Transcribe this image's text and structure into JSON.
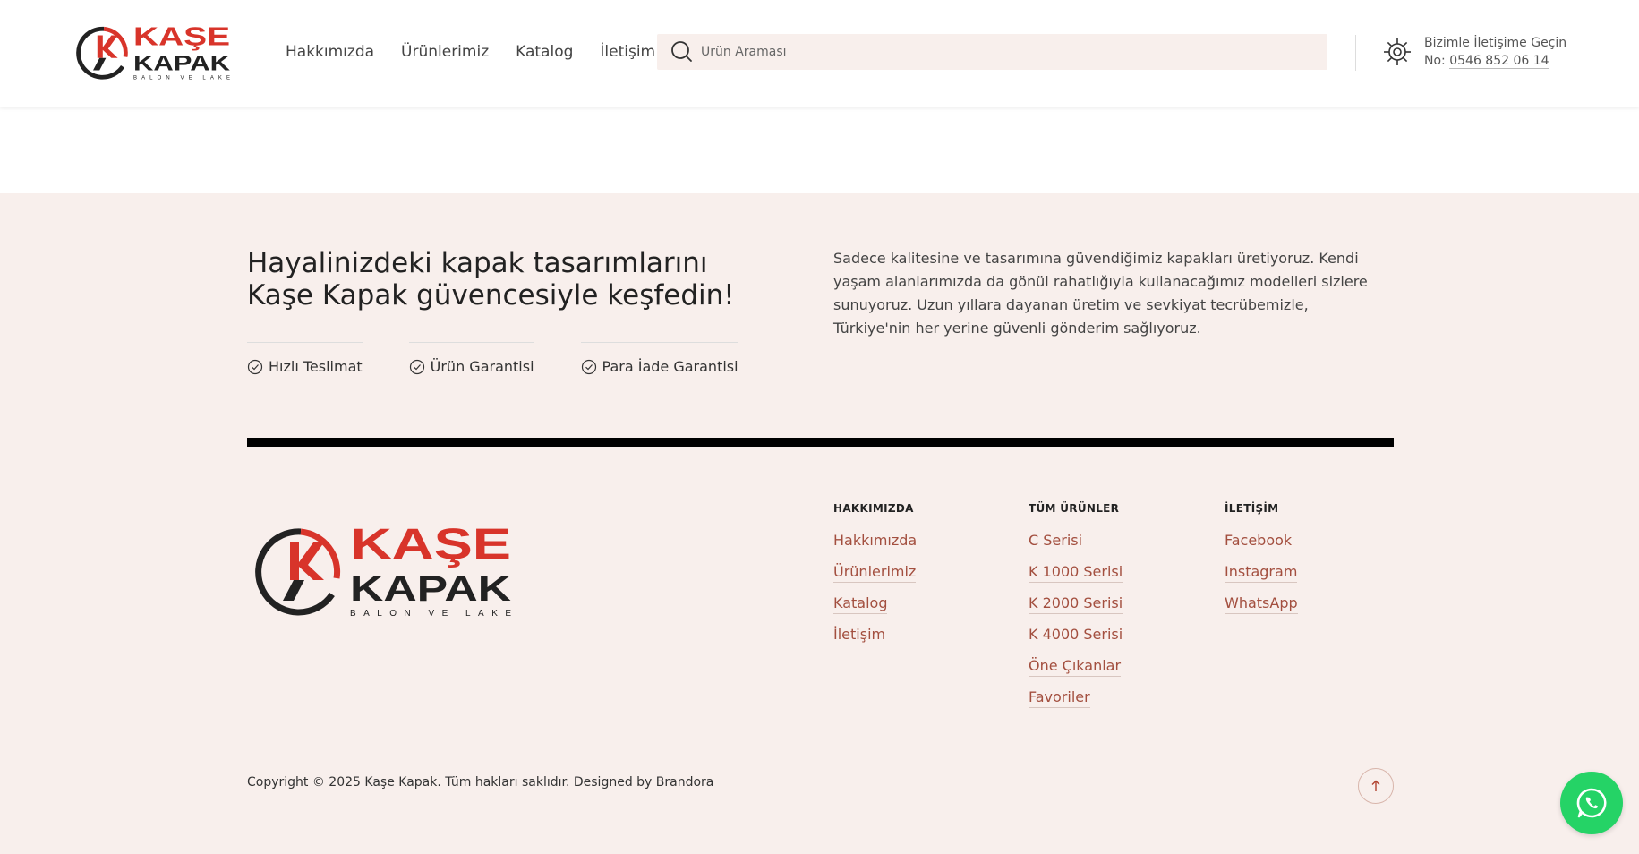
{
  "brand": {
    "name_top": "KAŞE",
    "name_bottom": "KAPAK",
    "subtitle": "BALON VE LAKE",
    "primary_color": "#d8342a",
    "dark_color": "#222222"
  },
  "header": {
    "nav": [
      {
        "label": "Hakkımızda"
      },
      {
        "label": "Ürünlerimiz"
      },
      {
        "label": "Katalog"
      },
      {
        "label": "İletişim"
      }
    ],
    "search": {
      "placeholder": "Ürün Araması",
      "icon": "search-icon"
    },
    "contact": {
      "icon": "gear-icon",
      "line1": "Bizimle İletişime Geçin",
      "prefix": "No:",
      "phone": "0546 852 06 14"
    }
  },
  "footer": {
    "tagline": "Hayalinizdeki kapak tasarımlarını Kaşe Kapak güvencesiyle keşfedin!",
    "badges": [
      {
        "label": "Hızlı Teslimat",
        "icon": "check-circle-icon"
      },
      {
        "label": "Ürün Garantisi",
        "icon": "check-circle-icon"
      },
      {
        "label": "Para İade Garantisi",
        "icon": "check-circle-icon"
      }
    ],
    "about": "Sadece kalitesine ve tasarımına güvendiğimiz kapakları üretiyoruz. Kendi yaşam alanlarımızda da gönül rahatlığıyla kullanacağımız modelleri sizlere sunuyoruz. Uzun yıllara dayanan üretim ve sevkiyat tecrübemizle, Türkiye'nin her yerine güvenli gönderim sağlıyoruz.",
    "columns": [
      {
        "title": "HAKKIMIZDA",
        "links": [
          "Hakkımızda",
          "Ürünlerimiz",
          "Katalog",
          "İletişim"
        ]
      },
      {
        "title": "TÜM ÜRÜNLER",
        "links": [
          "C Serisi",
          "K 1000 Serisi",
          "K 2000 Serisi",
          "K 4000 Serisi",
          "Öne Çıkanlar",
          "Favoriler"
        ]
      },
      {
        "title": "İLETİŞİM",
        "links": [
          "Facebook",
          "Instagram",
          "WhatsApp"
        ]
      }
    ],
    "copyright": "Copyright © 2025 Kaşe Kapak. Tüm hakları saklıdır. Designed by Brandora",
    "to_top_icon": "arrow-up-icon"
  },
  "floating": {
    "whatsapp_icon": "whatsapp-icon",
    "whatsapp_color": "#25d366"
  }
}
